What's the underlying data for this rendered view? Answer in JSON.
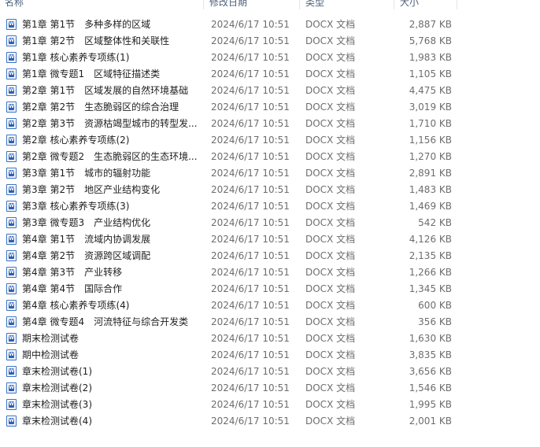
{
  "columns": {
    "name": "名称",
    "date": "修改日期",
    "type": "类型",
    "size": "大小"
  },
  "files": [
    {
      "name": "第1章 第1节　多种多样的区域",
      "date": "2024/6/17 10:51",
      "type": "DOCX 文档",
      "size": "2,887 KB"
    },
    {
      "name": "第1章 第2节　区域整体性和关联性",
      "date": "2024/6/17 10:51",
      "type": "DOCX 文档",
      "size": "5,768 KB"
    },
    {
      "name": "第1章 核心素养专项练(1)",
      "date": "2024/6/17 10:51",
      "type": "DOCX 文档",
      "size": "1,983 KB"
    },
    {
      "name": "第1章 微专题1　区域特征描述类",
      "date": "2024/6/17 10:51",
      "type": "DOCX 文档",
      "size": "1,105 KB"
    },
    {
      "name": "第2章 第1节　区域发展的自然环境基础",
      "date": "2024/6/17 10:51",
      "type": "DOCX 文档",
      "size": "4,475 KB"
    },
    {
      "name": "第2章 第2节　生态脆弱区的综合治理",
      "date": "2024/6/17 10:51",
      "type": "DOCX 文档",
      "size": "3,019 KB"
    },
    {
      "name": "第2章 第3节　资源枯竭型城市的转型发...",
      "date": "2024/6/17 10:51",
      "type": "DOCX 文档",
      "size": "1,710 KB"
    },
    {
      "name": "第2章 核心素养专项练(2)",
      "date": "2024/6/17 10:51",
      "type": "DOCX 文档",
      "size": "1,156 KB"
    },
    {
      "name": "第2章 微专题2　生态脆弱区的生态环境...",
      "date": "2024/6/17 10:51",
      "type": "DOCX 文档",
      "size": "1,270 KB"
    },
    {
      "name": "第3章 第1节　城市的辐射功能",
      "date": "2024/6/17 10:51",
      "type": "DOCX 文档",
      "size": "2,891 KB"
    },
    {
      "name": "第3章 第2节　地区产业结构变化",
      "date": "2024/6/17 10:51",
      "type": "DOCX 文档",
      "size": "1,483 KB"
    },
    {
      "name": "第3章 核心素养专项练(3)",
      "date": "2024/6/17 10:51",
      "type": "DOCX 文档",
      "size": "1,469 KB"
    },
    {
      "name": "第3章 微专题3　产业结构优化",
      "date": "2024/6/17 10:51",
      "type": "DOCX 文档",
      "size": "542 KB"
    },
    {
      "name": "第4章 第1节　流域内协调发展",
      "date": "2024/6/17 10:51",
      "type": "DOCX 文档",
      "size": "4,126 KB"
    },
    {
      "name": "第4章 第2节　资源跨区域调配",
      "date": "2024/6/17 10:51",
      "type": "DOCX 文档",
      "size": "2,135 KB"
    },
    {
      "name": "第4章 第3节　产业转移",
      "date": "2024/6/17 10:51",
      "type": "DOCX 文档",
      "size": "1,266 KB"
    },
    {
      "name": "第4章 第4节　国际合作",
      "date": "2024/6/17 10:51",
      "type": "DOCX 文档",
      "size": "1,345 KB"
    },
    {
      "name": "第4章 核心素养专项练(4)",
      "date": "2024/6/17 10:51",
      "type": "DOCX 文档",
      "size": "600 KB"
    },
    {
      "name": "第4章 微专题4　河流特征与综合开发类",
      "date": "2024/6/17 10:51",
      "type": "DOCX 文档",
      "size": "356 KB"
    },
    {
      "name": "期末检测试卷",
      "date": "2024/6/17 10:51",
      "type": "DOCX 文档",
      "size": "1,630 KB"
    },
    {
      "name": "期中检测试卷",
      "date": "2024/6/17 10:51",
      "type": "DOCX 文档",
      "size": "3,835 KB"
    },
    {
      "name": "章末检测试卷(1)",
      "date": "2024/6/17 10:51",
      "type": "DOCX 文档",
      "size": "3,656 KB"
    },
    {
      "name": "章末检测试卷(2)",
      "date": "2024/6/17 10:51",
      "type": "DOCX 文档",
      "size": "1,546 KB"
    },
    {
      "name": "章末检测试卷(3)",
      "date": "2024/6/17 10:51",
      "type": "DOCX 文档",
      "size": "1,995 KB"
    },
    {
      "name": "章末检测试卷(4)",
      "date": "2024/6/17 10:51",
      "type": "DOCX 文档",
      "size": "2,001 KB"
    }
  ],
  "icons": {
    "file_icon": "word-document-icon",
    "accent_color": "#2b5fb4"
  }
}
